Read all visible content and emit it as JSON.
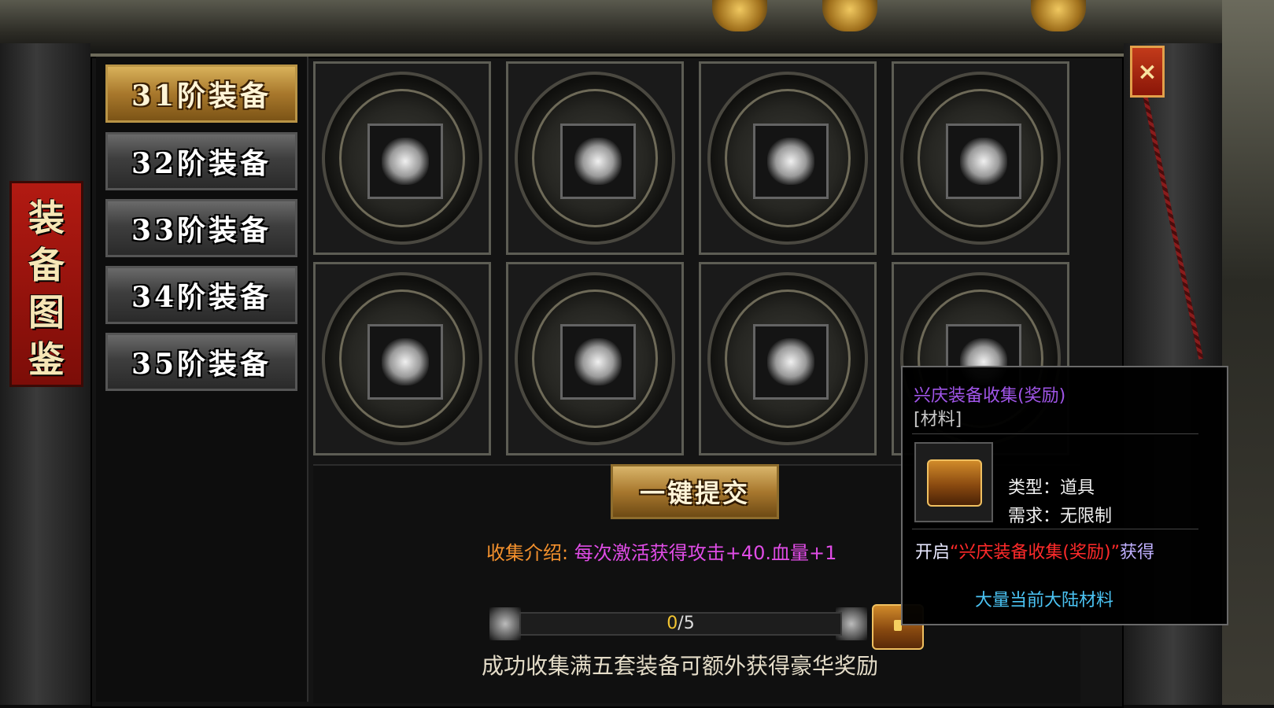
{
  "side_title": [
    "装",
    "备",
    "图",
    "鉴"
  ],
  "tabs": [
    {
      "label": "31阶装备",
      "active": true
    },
    {
      "label": "32阶装备",
      "active": false
    },
    {
      "label": "33阶装备",
      "active": false
    },
    {
      "label": "34阶装备",
      "active": false
    },
    {
      "label": "35阶装备",
      "active": false
    }
  ],
  "slots": [
    {
      "icon": "sword-item-icon"
    },
    {
      "icon": "armor-item-icon"
    },
    {
      "icon": "helmet-item-icon"
    },
    {
      "icon": "necklace-item-icon"
    },
    {
      "icon": "gloves-item-icon"
    },
    {
      "icon": "ring-item-icon"
    },
    {
      "icon": "belt-item-icon"
    },
    {
      "icon": "boots-item-icon"
    }
  ],
  "submit_button": "一键提交",
  "intro": {
    "label": "收集介绍:",
    "value": "每次激活获得攻击+40.血量+1"
  },
  "progress": {
    "current": "0",
    "total": "/5",
    "fraction": 0
  },
  "bottom_note": "成功收集满五套装备可额外获得豪华奖励",
  "close_label": "×",
  "tooltip": {
    "title": "兴庆装备收集(奖励)",
    "subtitle": "[材料]",
    "type_line": "类型：道具",
    "req_line": "需求：无限制",
    "open_prefix": "开启",
    "open_item": "“兴庆装备收集(奖励)”",
    "open_suffix": "获得",
    "footer": "大量当前大陆材料"
  },
  "colors": {
    "gold": "#caa040",
    "tooltip_title": "#a055e8",
    "tooltip_red": "#ff2a2a",
    "tooltip_cyan": "#4bc4f4",
    "intro_label": "#f4912d",
    "intro_value": "#e04ce6"
  }
}
